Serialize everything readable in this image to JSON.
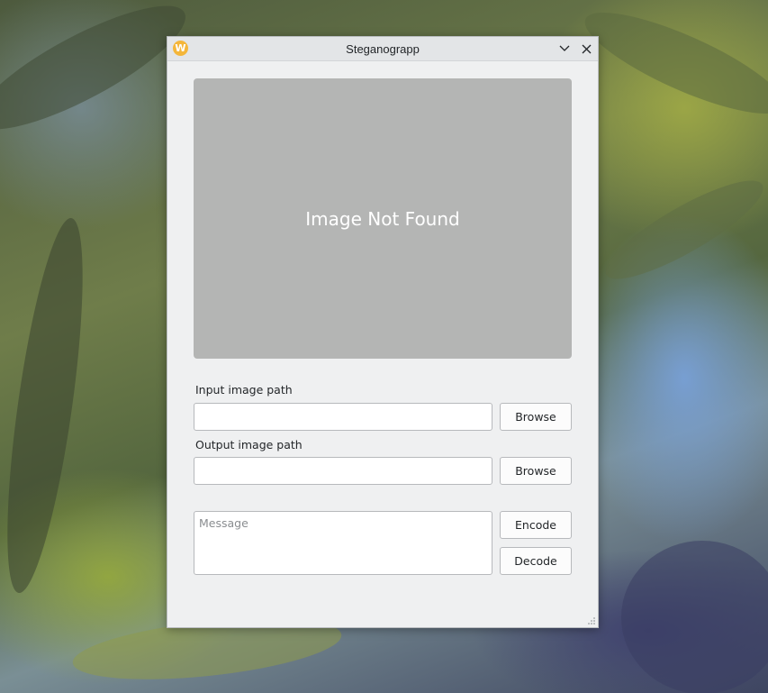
{
  "window": {
    "title": "Steganograpp",
    "app_icon_glyph": "W",
    "app_icon_color": "#f4b63a",
    "minimize_icon": "chevron-down-icon",
    "close_icon": "close-icon"
  },
  "preview": {
    "text": "Image Not Found",
    "background": "#b4b5b4"
  },
  "input": {
    "label": "Input image path",
    "value": "",
    "browse_label": "Browse"
  },
  "output": {
    "label": "Output image path",
    "value": "",
    "browse_label": "Browse"
  },
  "message": {
    "placeholder": "Message",
    "value": ""
  },
  "actions": {
    "encode_label": "Encode",
    "decode_label": "Decode"
  }
}
